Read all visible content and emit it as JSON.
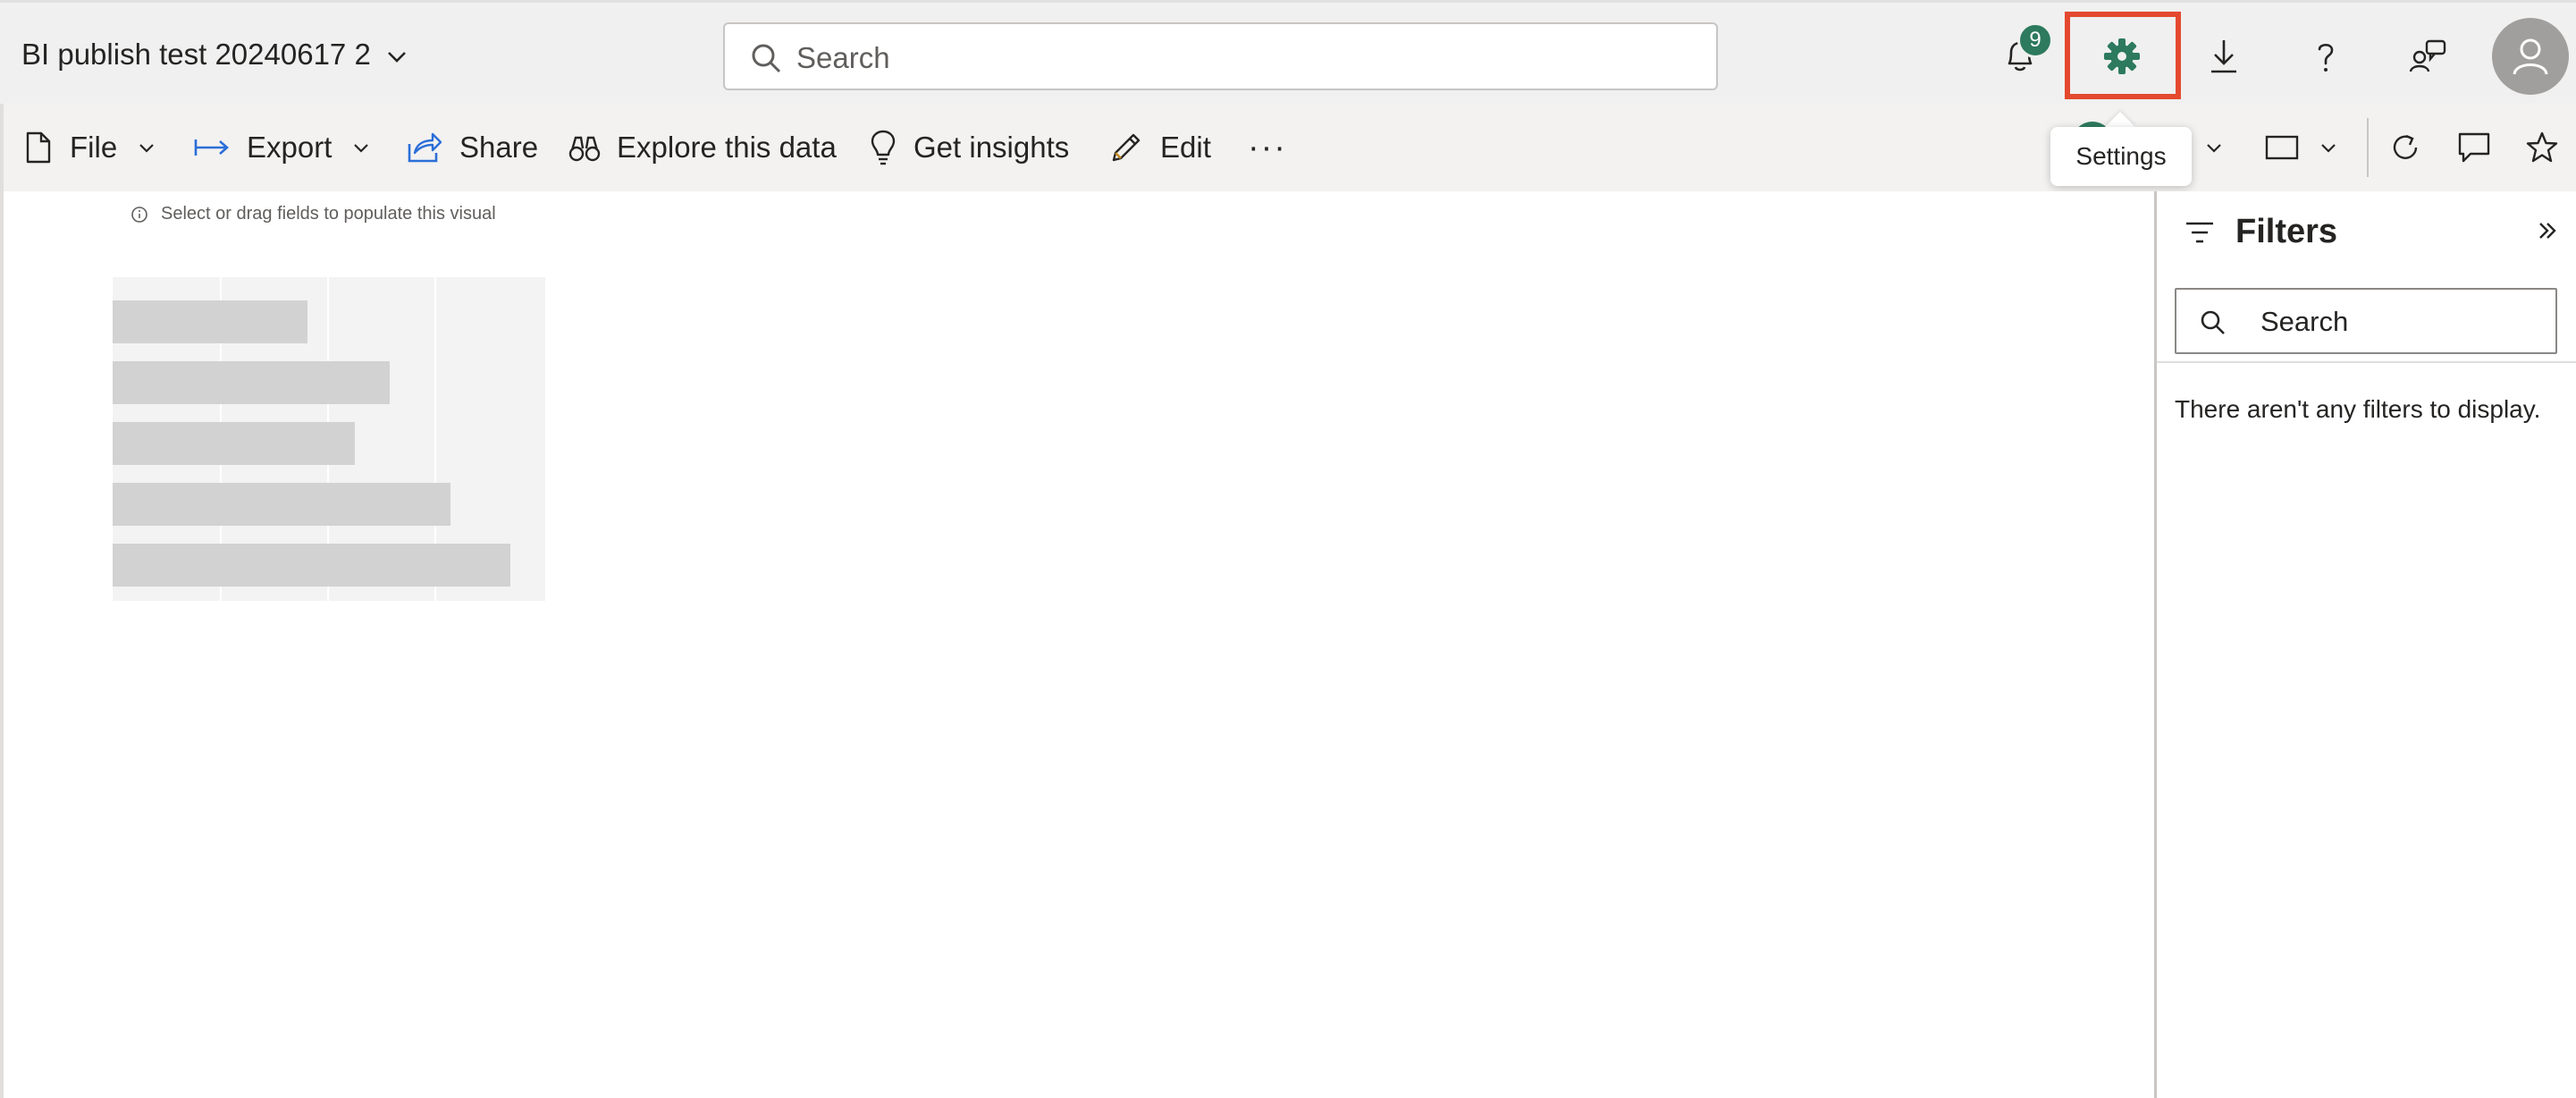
{
  "header": {
    "report_title": "BI publish test 20240617 2",
    "search_placeholder": "Search",
    "notification_count": "9"
  },
  "tooltip": {
    "text": "Settings"
  },
  "toolbar": {
    "file": "File",
    "export": "Export",
    "share": "Share",
    "explore": "Explore this data",
    "insights": "Get insights",
    "edit": "Edit",
    "more": "···"
  },
  "canvas": {
    "hint": "Select or drag fields to populate this visual"
  },
  "placeholder_visual": {
    "bar_levels": [
      0.45,
      0.64,
      0.56,
      0.78,
      0.92
    ]
  },
  "filters": {
    "title": "Filters",
    "search_placeholder": "Search",
    "empty_message": "There aren't any filters to display."
  },
  "colors": {
    "accent_green": "#2d7a5f",
    "highlight_red": "#e4492f",
    "header_bg": "#f0f0f0"
  }
}
